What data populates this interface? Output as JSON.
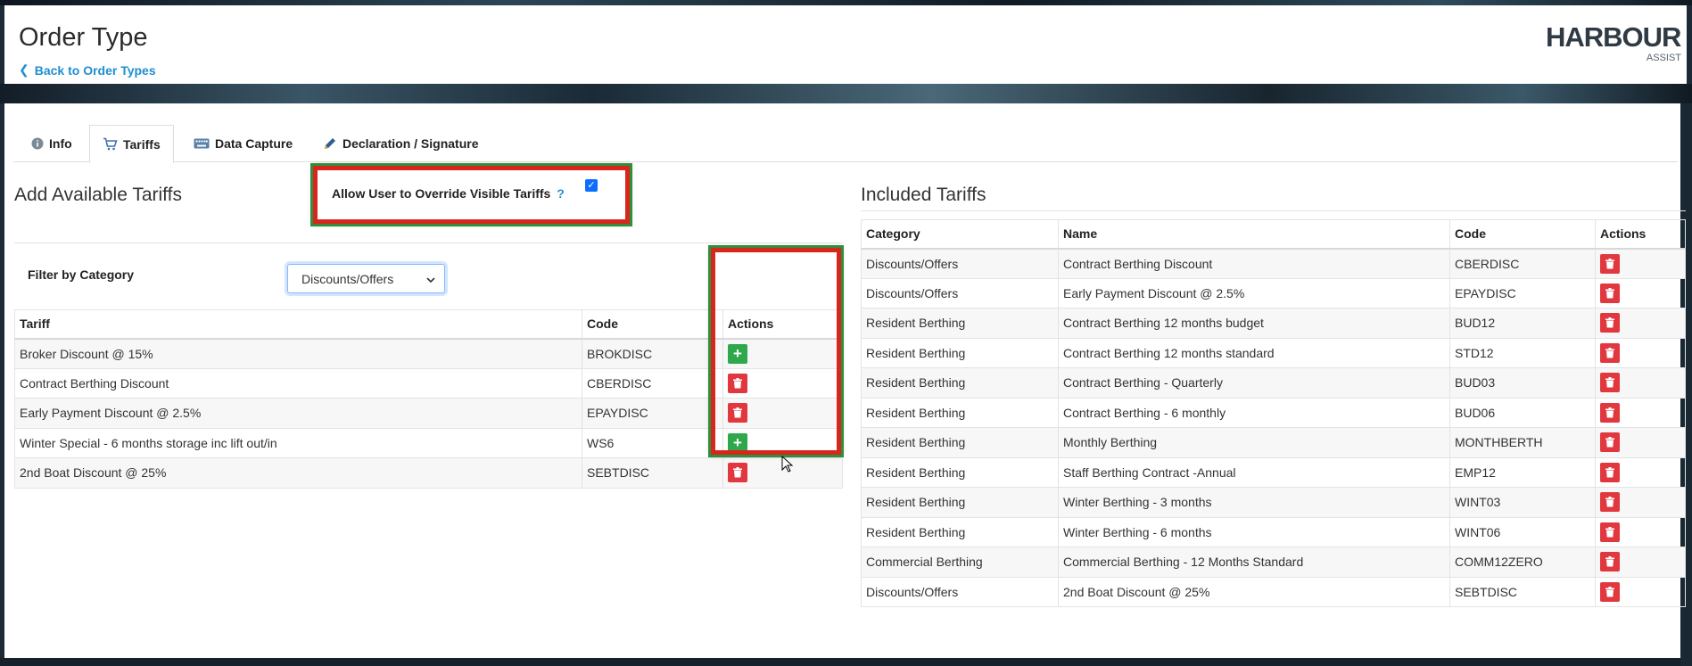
{
  "header": {
    "title": "Order Type",
    "back_link": "Back to Order Types",
    "logo_text": "HARBOUR",
    "logo_sub": "ASSIST"
  },
  "tabs": [
    {
      "label": "Info",
      "icon": "info-icon",
      "active": false
    },
    {
      "label": "Tariffs",
      "icon": "cart-icon",
      "active": true
    },
    {
      "label": "Data Capture",
      "icon": "keyboard-icon",
      "active": false
    },
    {
      "label": "Declaration / Signature",
      "icon": "pen-icon",
      "active": false
    }
  ],
  "override": {
    "label": "Allow User to Override Visible Tariffs",
    "help": "?",
    "checked": true
  },
  "available": {
    "title": "Add Available Tariffs",
    "filter_label": "Filter by Category",
    "filter_value": "Discounts/Offers",
    "columns": [
      "Tariff",
      "Code",
      "Actions"
    ],
    "rows": [
      {
        "tariff": "Broker Discount @ 15%",
        "code": "BROKDISC",
        "action": "add"
      },
      {
        "tariff": "Contract Berthing Discount",
        "code": "CBERDISC",
        "action": "remove"
      },
      {
        "tariff": "Early Payment Discount @ 2.5%",
        "code": "EPAYDISC",
        "action": "remove"
      },
      {
        "tariff": "Winter Special - 6 months storage inc lift out/in",
        "code": "WS6",
        "action": "add"
      },
      {
        "tariff": "2nd Boat Discount @ 25%",
        "code": "SEBTDISC",
        "action": "remove"
      }
    ]
  },
  "included": {
    "title": "Included Tariffs",
    "columns": [
      "Category",
      "Name",
      "Code",
      "Actions"
    ],
    "rows": [
      {
        "category": "Discounts/Offers",
        "name": "Contract Berthing Discount",
        "code": "CBERDISC"
      },
      {
        "category": "Discounts/Offers",
        "name": "Early Payment Discount @ 2.5%",
        "code": "EPAYDISC"
      },
      {
        "category": "Resident Berthing",
        "name": "Contract Berthing 12 months budget",
        "code": "BUD12"
      },
      {
        "category": "Resident Berthing",
        "name": "Contract Berthing 12 months standard",
        "code": "STD12"
      },
      {
        "category": "Resident Berthing",
        "name": "Contract Berthing - Quarterly",
        "code": "BUD03"
      },
      {
        "category": "Resident Berthing",
        "name": "Contract Berthing - 6 monthly",
        "code": "BUD06"
      },
      {
        "category": "Resident Berthing",
        "name": "Monthly Berthing",
        "code": "MONTHBERTH"
      },
      {
        "category": "Resident Berthing",
        "name": "Staff Berthing Contract -Annual",
        "code": "EMP12"
      },
      {
        "category": "Resident Berthing",
        "name": "Winter Berthing - 3 months",
        "code": "WINT03"
      },
      {
        "category": "Resident Berthing",
        "name": "Winter Berthing - 6 months",
        "code": "WINT06"
      },
      {
        "category": "Commercial Berthing",
        "name": "Commercial Berthing - 12 Months Standard",
        "code": "COMM12ZERO"
      },
      {
        "category": "Discounts/Offers",
        "name": "2nd Boat Discount @ 25%",
        "code": "SEBTDISC"
      }
    ]
  },
  "colors": {
    "link": "#1f8fd0",
    "add": "#2ea84b",
    "remove": "#e0383e",
    "highlight_border": "#d9261c"
  }
}
